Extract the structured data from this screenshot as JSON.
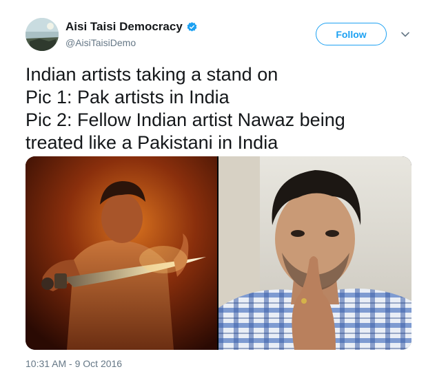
{
  "user": {
    "display_name": "Aisi Taisi Democracy",
    "handle": "@AisiTaisiDemo",
    "verified": true,
    "avatar_icon": "profile-avatar"
  },
  "actions": {
    "follow_label": "Follow",
    "more_icon": "chevron-down-icon"
  },
  "tweet": {
    "lines": [
      "Indian artists taking a stand on",
      "Pic 1: Pak artists in India",
      "Pic 2: Fellow Indian artist Nawaz being",
      "treated like a Pakistani in India"
    ],
    "timestamp": "10:31 AM - 9 Oct 2016"
  },
  "media": {
    "count": 2
  },
  "colors": {
    "accent": "#1da1f2",
    "text": "#14171a",
    "muted": "#657786"
  }
}
